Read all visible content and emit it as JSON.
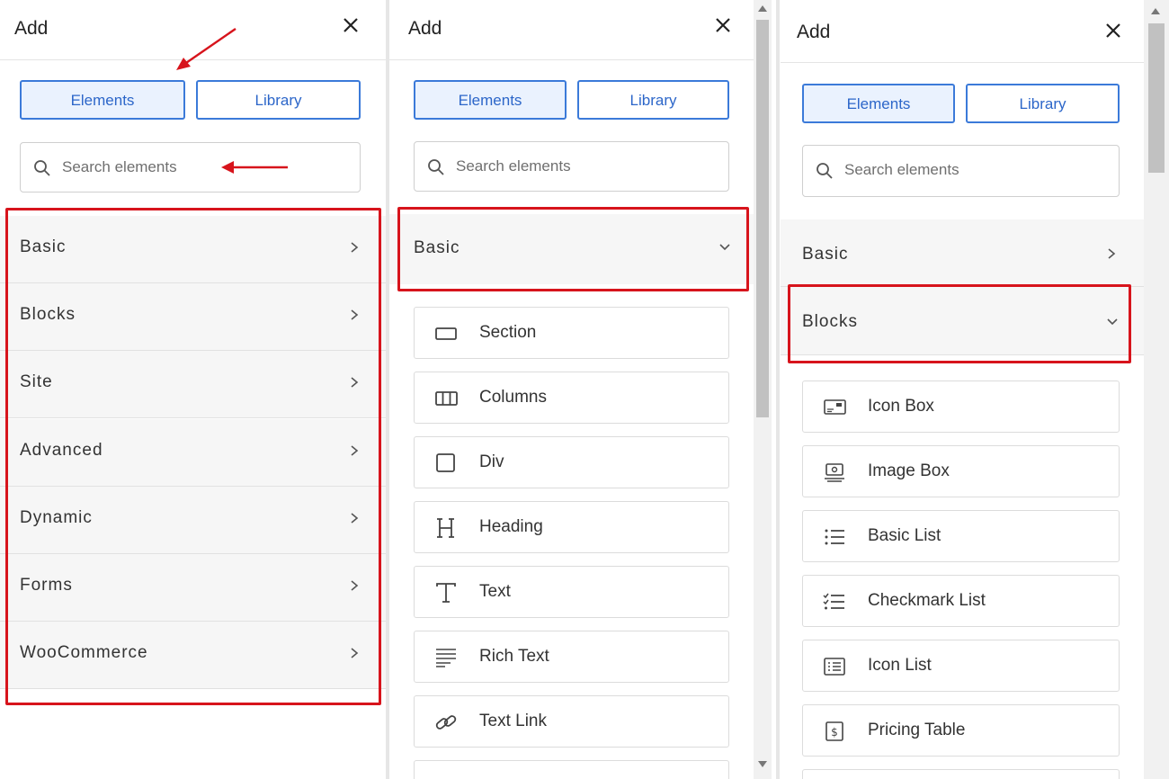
{
  "panel1": {
    "title": "Add",
    "tabs": {
      "elements": "Elements",
      "library": "Library"
    },
    "search_placeholder": "Search elements",
    "categories": [
      "Basic",
      "Blocks",
      "Site",
      "Advanced",
      "Dynamic",
      "Forms",
      "WooCommerce"
    ]
  },
  "panel2": {
    "title": "Add",
    "tabs": {
      "elements": "Elements",
      "library": "Library"
    },
    "search_placeholder": "Search elements",
    "expanded_category": "Basic",
    "items": [
      "Section",
      "Columns",
      "Div",
      "Heading",
      "Text",
      "Rich Text",
      "Text Link"
    ]
  },
  "panel3": {
    "title": "Add",
    "tabs": {
      "elements": "Elements",
      "library": "Library"
    },
    "search_placeholder": "Search elements",
    "categories": [
      "Basic",
      "Blocks"
    ],
    "expanded_category": "Blocks",
    "items": [
      "Icon Box",
      "Image Box",
      "Basic List",
      "Checkmark List",
      "Icon List",
      "Pricing Table"
    ]
  },
  "colors": {
    "accent": "#3b7ad9",
    "highlight": "#d7141c",
    "category_bg": "#f6f6f6"
  },
  "icons": [
    "close-icon",
    "search-icon",
    "chevron-right-icon",
    "chevron-down-icon",
    "section-icon",
    "columns-icon",
    "div-icon",
    "heading-icon",
    "text-icon",
    "rich-text-icon",
    "text-link-icon",
    "icon-box-icon",
    "image-box-icon",
    "basic-list-icon",
    "checkmark-list-icon",
    "icon-list-icon",
    "pricing-table-icon"
  ]
}
